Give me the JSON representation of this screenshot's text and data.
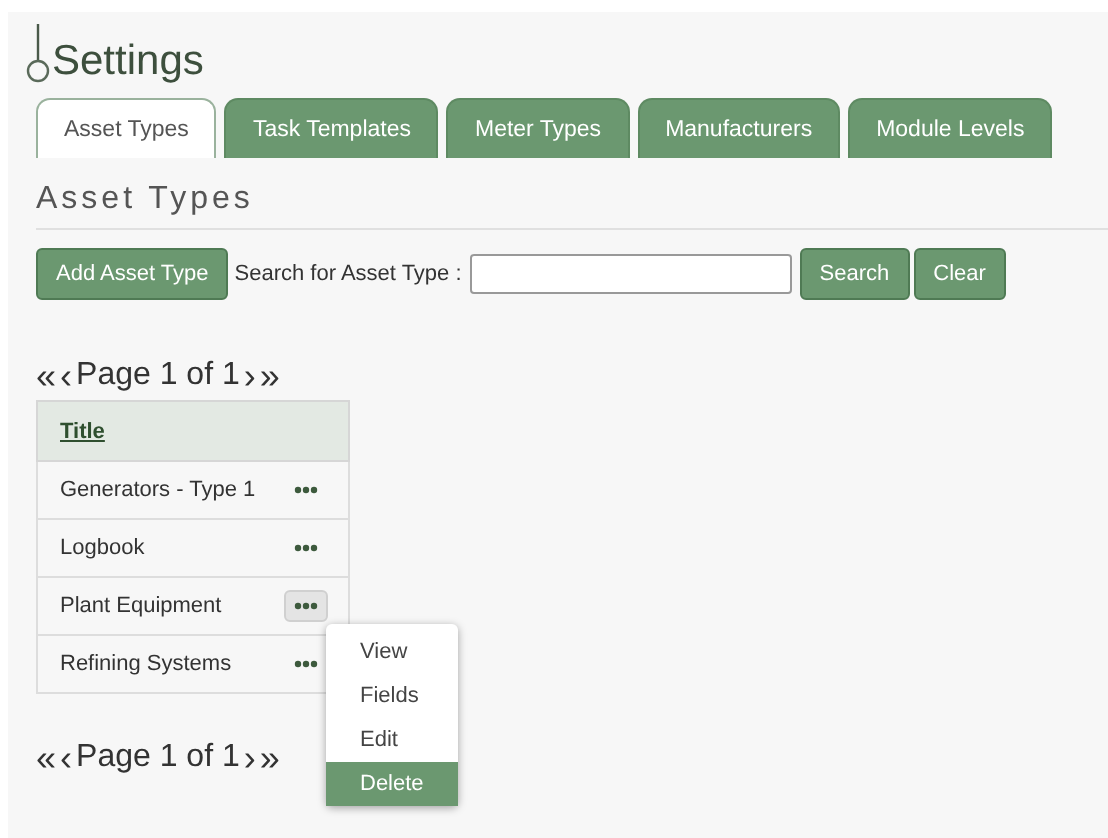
{
  "page_title": "Settings",
  "tabs": [
    {
      "label": "Asset Types",
      "selected": true
    },
    {
      "label": "Task Templates",
      "selected": false
    },
    {
      "label": "Meter Types",
      "selected": false
    },
    {
      "label": "Manufacturers",
      "selected": false
    },
    {
      "label": "Module Levels",
      "selected": false
    }
  ],
  "section_title": "Asset Types",
  "toolbar": {
    "add_button": "Add Asset Type",
    "search_label": "Search for Asset Type :",
    "search_button": "Search",
    "clear_button": "Clear"
  },
  "pagination_top": {
    "first": "«",
    "prev": "‹",
    "text": "Page 1 of 1",
    "next": "›",
    "last": "»"
  },
  "table": {
    "columns": [
      "Title"
    ],
    "rows": [
      {
        "title": "Generators - Type 1",
        "menu_open": false
      },
      {
        "title": "Logbook",
        "menu_open": false
      },
      {
        "title": "Plant Equipment",
        "menu_open": true
      },
      {
        "title": "Refining Systems",
        "menu_open": false
      }
    ]
  },
  "context_menu": [
    {
      "label": "View",
      "selected": false
    },
    {
      "label": "Fields",
      "selected": false
    },
    {
      "label": "Edit",
      "selected": false
    },
    {
      "label": "Delete",
      "selected": true
    }
  ],
  "pagination_bottom": {
    "first": "«",
    "prev": "‹",
    "text": "Page 1 of 1",
    "next": "›",
    "last": "»"
  }
}
